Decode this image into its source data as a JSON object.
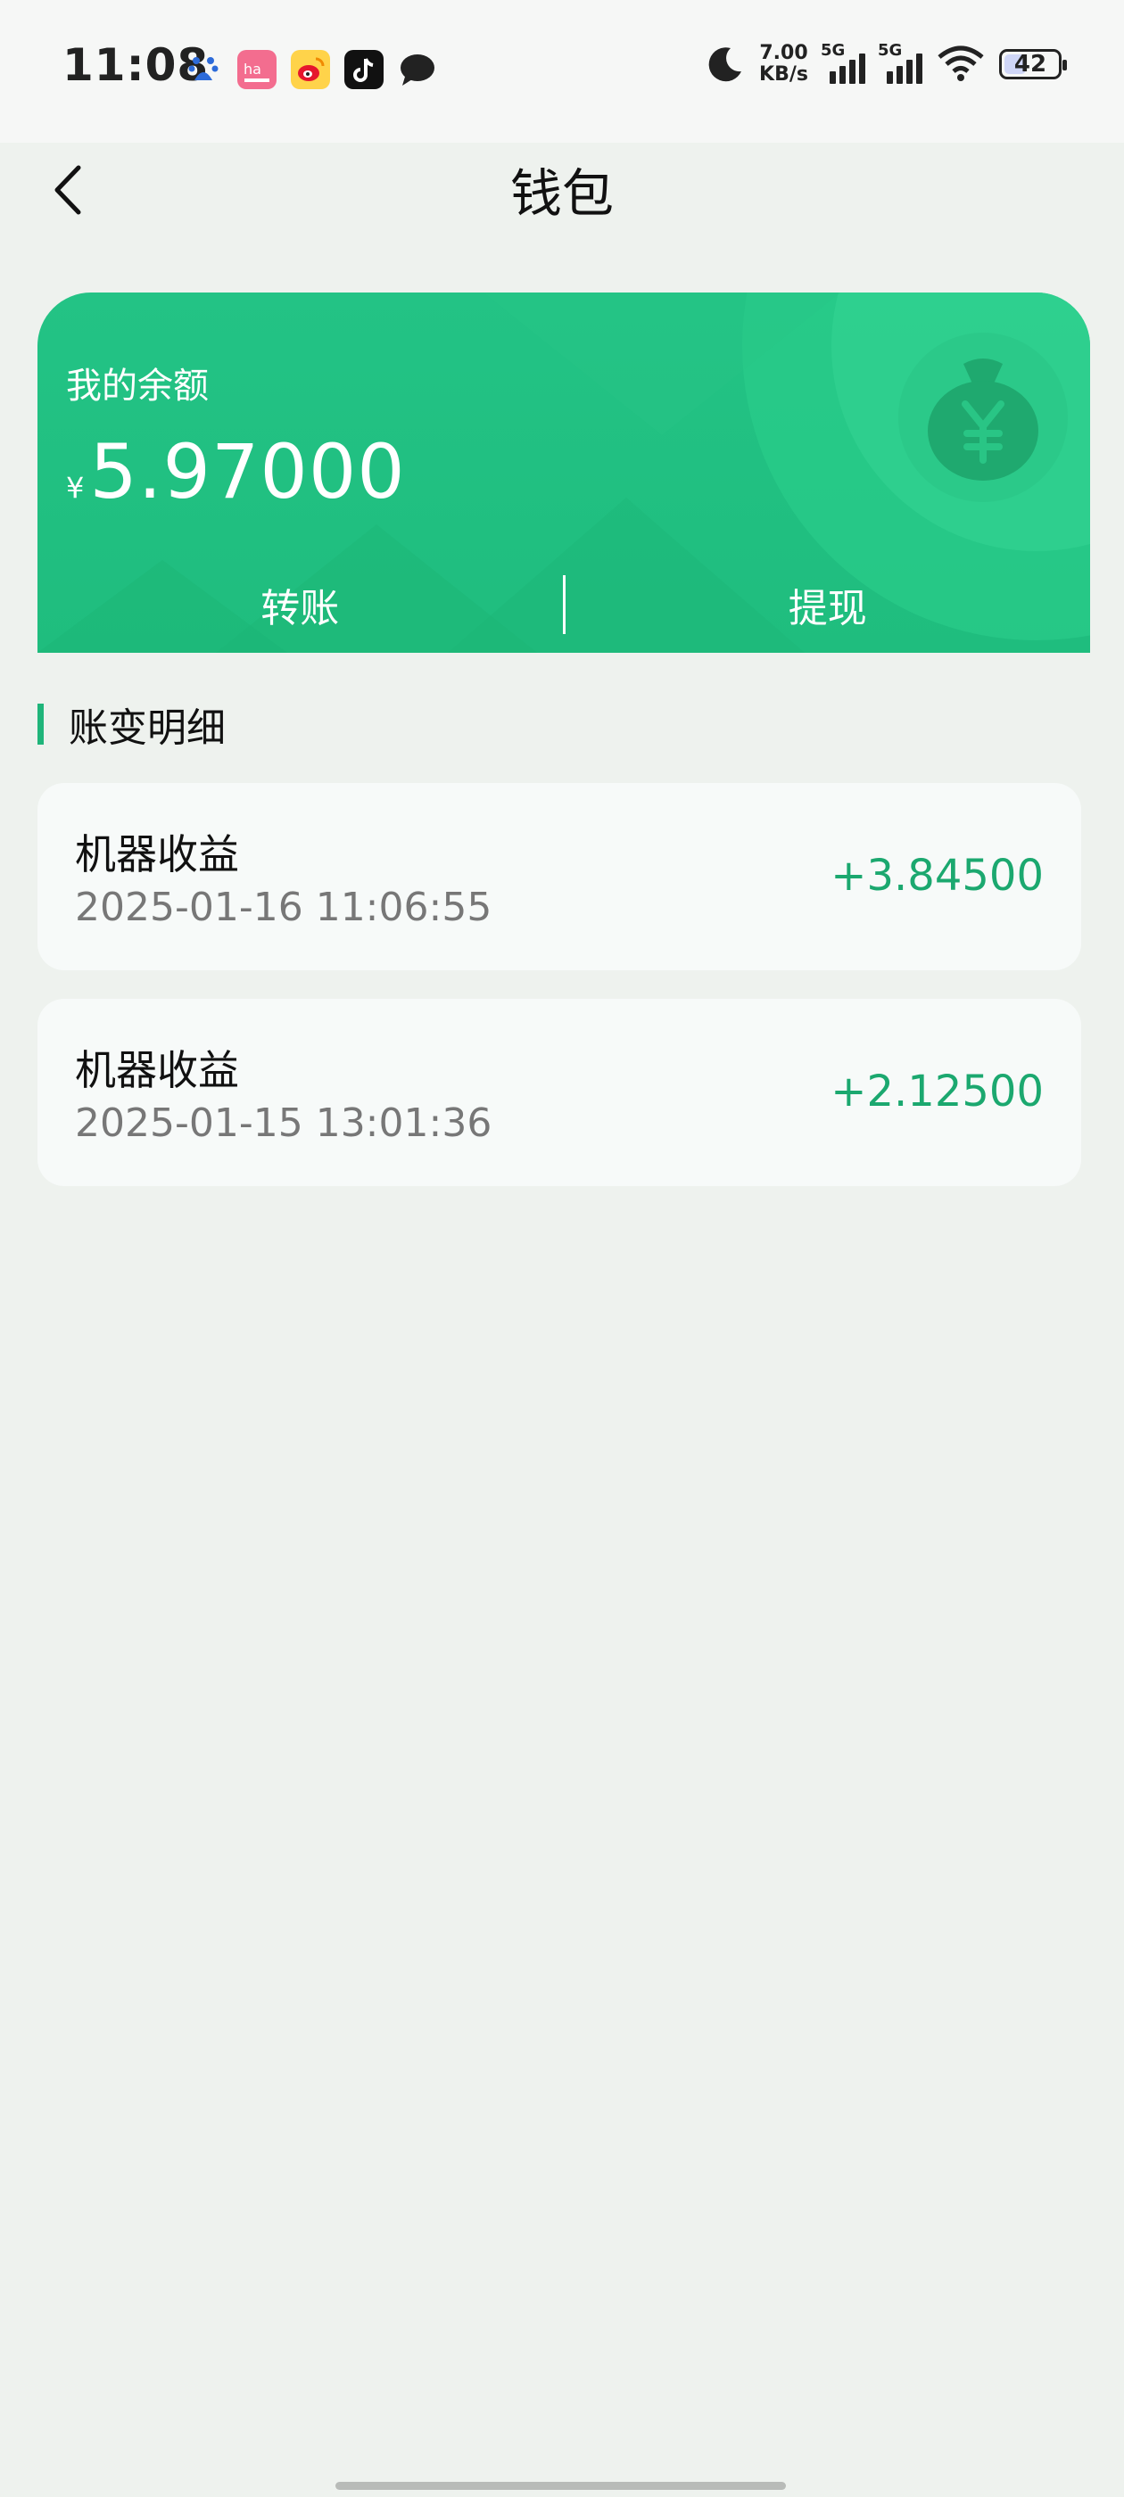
{
  "status_bar": {
    "time": "11:08",
    "net_speed_value": "7.00",
    "net_speed_unit": "KB/s",
    "sim1_label": "5G",
    "sim2_label": "5G",
    "battery": "42",
    "battery_level": 0.42
  },
  "header": {
    "title": "钱包"
  },
  "wallet_card": {
    "balance_label": "我的余额",
    "currency_symbol": "¥",
    "balance": "5.97000",
    "transfer_label": "转账",
    "withdraw_label": "提现",
    "accent_color": "#1fbd7e"
  },
  "transactions": {
    "section_title": "账变明细",
    "items": [
      {
        "name": "机器收益",
        "date": "2025-01-16 11:06:55",
        "amount": "+3.84500"
      },
      {
        "name": "机器收益",
        "date": "2025-01-15 13:01:36",
        "amount": "+2.12500"
      }
    ]
  },
  "icons": [
    "baidu-icon",
    "app-pink-icon",
    "weibo-icon",
    "tiktok-icon",
    "chat-bubble-icon",
    "moon-icon",
    "wifi-icon",
    "money-bag-icon",
    "back-icon"
  ]
}
